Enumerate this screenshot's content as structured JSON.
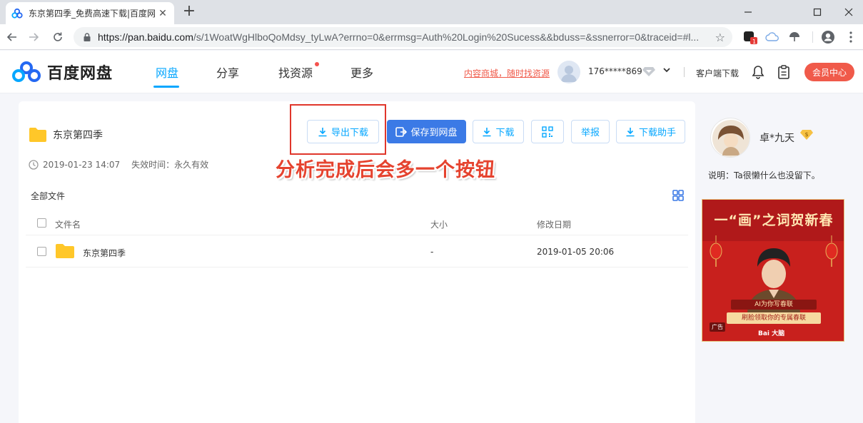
{
  "browser": {
    "tab_title": "东京第四季_免费高速下载|百度网",
    "url_main": "https://pan.baidu.com",
    "url_rest": "/s/1WoatWgHlboQoMdsy_tyLwA?errno=0&errmsg=Auth%20Login%20Sucess&&bduss=&ssnerror=0&traceid=#l...",
    "new_tab": "+",
    "close_tab": "✕",
    "ext_badge": "1"
  },
  "header": {
    "logo_text": "百度网盘",
    "nav": [
      "网盘",
      "分享",
      "找资源",
      "更多"
    ],
    "promo": "内容商城，随时找资源",
    "username": "176*****869",
    "client_download": "客户端下载",
    "vip_button": "会员中心"
  },
  "share": {
    "folder_name": "东京第四季",
    "date": "2019-01-23 14:07",
    "expire": "失效时间：永久有效",
    "buttons": {
      "export_download": "导出下载",
      "save_to_pan": "保存到网盘",
      "download": "下载",
      "report": "举报",
      "download_helper": "下载助手"
    },
    "annotation": "分析完成后会多一个按钮",
    "all_files": "全部文件",
    "columns": {
      "name": "文件名",
      "size": "大小",
      "date": "修改日期"
    },
    "rows": [
      {
        "name": "东京第四季",
        "size": "-",
        "date": "2019-01-05 20:06"
      }
    ]
  },
  "sidebar": {
    "name": "卓*九天",
    "desc": "说明：Ta很懒什么也没留下。",
    "ad": {
      "title": "一“画”之词贺新春",
      "sub1": "AI为你写春联",
      "sub2": "刷脸领取你的专属春联",
      "tag": "广告",
      "brand": "Bai 大脑"
    }
  },
  "colors": {
    "accent": "#06a7ff",
    "primary_button": "#3b7ae6",
    "vip": "#f05a4a",
    "annotation": "#e5432f"
  }
}
